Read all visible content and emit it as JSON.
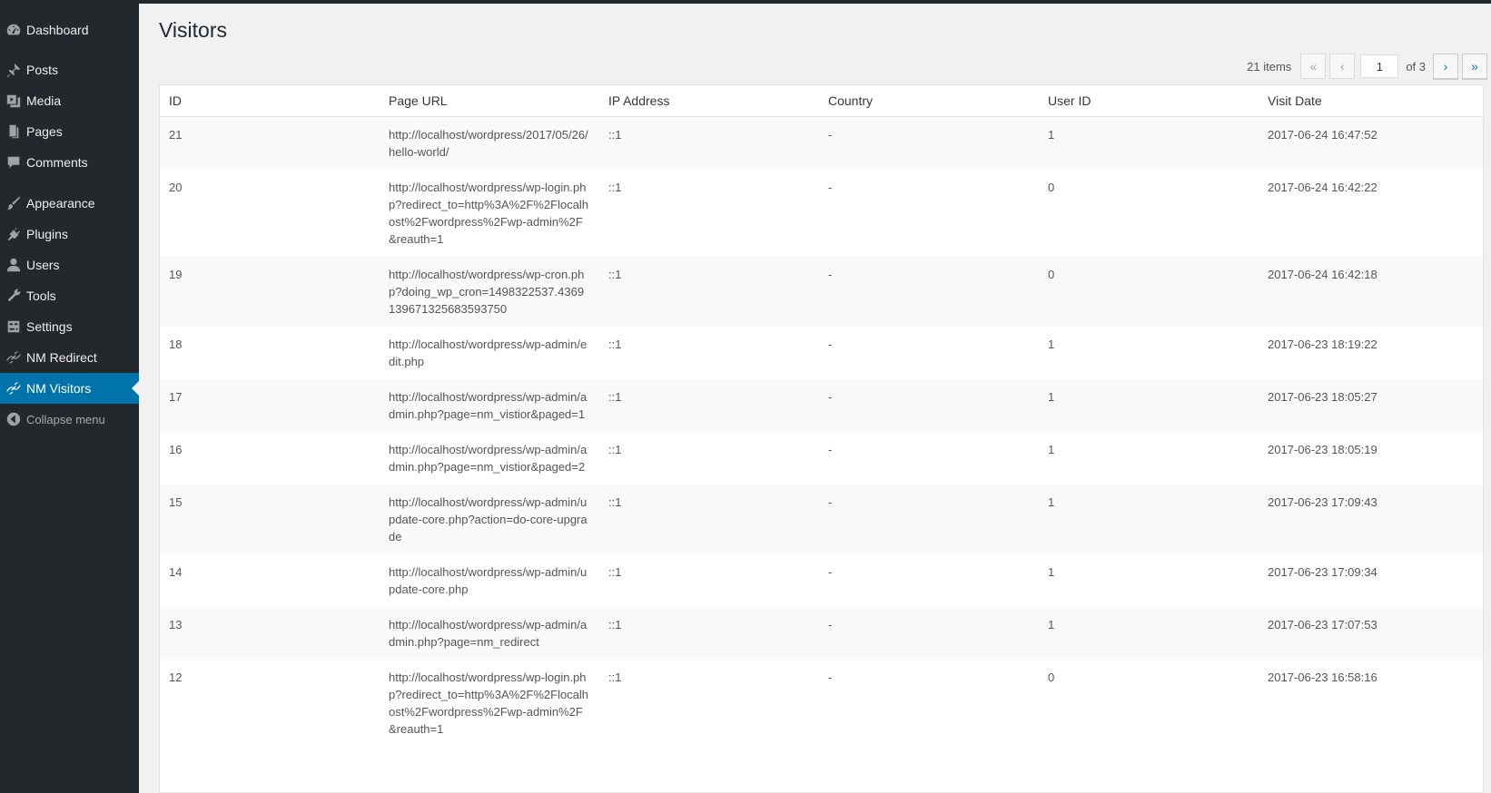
{
  "sidebar": {
    "items": [
      {
        "label": "Dashboard",
        "icon": "dashboard-icon"
      },
      {
        "label": "Posts",
        "icon": "pin-icon"
      },
      {
        "label": "Media",
        "icon": "media-icon"
      },
      {
        "label": "Pages",
        "icon": "pages-icon"
      },
      {
        "label": "Comments",
        "icon": "comment-icon"
      },
      {
        "label": "Appearance",
        "icon": "brush-icon"
      },
      {
        "label": "Plugins",
        "icon": "plugin-icon"
      },
      {
        "label": "Users",
        "icon": "user-icon"
      },
      {
        "label": "Tools",
        "icon": "wrench-icon"
      },
      {
        "label": "Settings",
        "icon": "settings-icon"
      },
      {
        "label": "NM Redirect",
        "icon": "link-icon"
      },
      {
        "label": "NM Visitors",
        "icon": "link-icon",
        "active": true
      },
      {
        "label": "Collapse menu",
        "icon": "collapse-icon"
      }
    ]
  },
  "page": {
    "title": "Visitors"
  },
  "pagination": {
    "count_label": "21 items",
    "first": "«",
    "prev": "‹",
    "current_page": "1",
    "of_label": "of 3",
    "next": "›",
    "last": "»"
  },
  "table": {
    "headers": [
      "ID",
      "Page URL",
      "IP Address",
      "Country",
      "User ID",
      "Visit Date"
    ],
    "rows": [
      [
        "21",
        "http://localhost/wordpress/2017/05/26/hello-world/",
        "::1",
        "-",
        "1",
        "2017-06-24 16:47:52"
      ],
      [
        "20",
        "http://localhost/wordpress/wp-login.php?redirect_to=http%3A%2F%2Flocalhost%2Fwordpress%2Fwp-admin%2F&reauth=1",
        "::1",
        "-",
        "0",
        "2017-06-24 16:42:22"
      ],
      [
        "19",
        "http://localhost/wordpress/wp-cron.php?doing_wp_cron=1498322537.4369139671325683593750",
        "::1",
        "-",
        "0",
        "2017-06-24 16:42:18"
      ],
      [
        "18",
        "http://localhost/wordpress/wp-admin/edit.php",
        "::1",
        "-",
        "1",
        "2017-06-23 18:19:22"
      ],
      [
        "17",
        "http://localhost/wordpress/wp-admin/admin.php?page=nm_vistior&paged=1",
        "::1",
        "-",
        "1",
        "2017-06-23 18:05:27"
      ],
      [
        "16",
        "http://localhost/wordpress/wp-admin/admin.php?page=nm_vistior&paged=2",
        "::1",
        "-",
        "1",
        "2017-06-23 18:05:19"
      ],
      [
        "15",
        "http://localhost/wordpress/wp-admin/update-core.php?action=do-core-upgrade",
        "::1",
        "-",
        "1",
        "2017-06-23 17:09:43"
      ],
      [
        "14",
        "http://localhost/wordpress/wp-admin/update-core.php",
        "::1",
        "-",
        "1",
        "2017-06-23 17:09:34"
      ],
      [
        "13",
        "http://localhost/wordpress/wp-admin/admin.php?page=nm_redirect",
        "::1",
        "-",
        "1",
        "2017-06-23 17:07:53"
      ],
      [
        "12",
        "http://localhost/wordpress/wp-login.php?redirect_to=http%3A%2F%2Flocalhost%2Fwordpress%2Fwp-admin%2F&reauth=1",
        "::1",
        "-",
        "0",
        "2017-06-23 16:58:16"
      ]
    ]
  },
  "colors": {
    "sidebar_bg": "#23282d",
    "active_bg": "#0073aa",
    "content_bg": "#f1f1f1"
  }
}
